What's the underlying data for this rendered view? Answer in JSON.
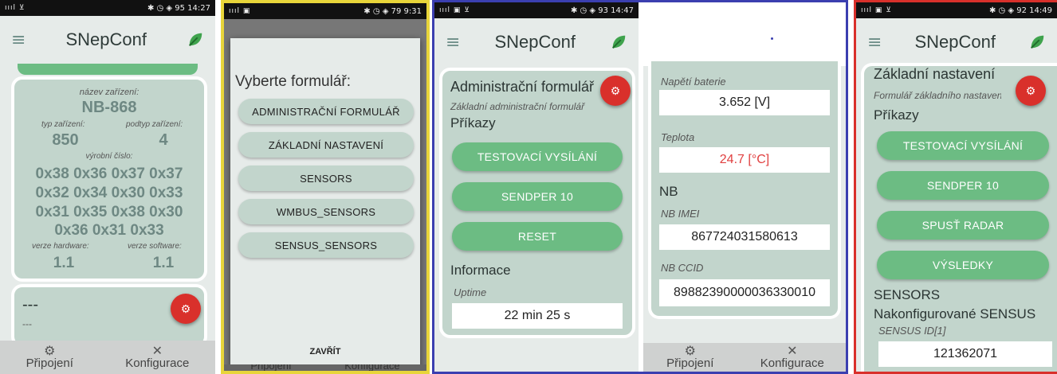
{
  "app_title": "SNepConf",
  "p1": {
    "status_left": "ıııl ⊻",
    "status_right": "✱ ◷ ◈ 95 14:27",
    "device_name_label": "název zařízení:",
    "device_name": "NB-868",
    "type_label": "typ zařízení:",
    "type": "850",
    "subtype_label": "podtyp zařízení:",
    "subtype": "4",
    "serial_label": "výrobní číslo:",
    "serial_lines": [
      "0x38 0x36 0x37 0x37",
      "0x32 0x34 0x30 0x33",
      "0x31 0x35 0x38 0x30",
      "0x36 0x31 0x33"
    ],
    "hw_label": "verze hardware:",
    "hw": "1.1",
    "sw_label": "verze software:",
    "sw": "1.1",
    "card2_title": "---",
    "card2_sub": "---",
    "nav_left": "Připojení",
    "nav_right": "Konfigurace"
  },
  "p2": {
    "status_left": "ıııl ▣",
    "status_right": "✱ ◷ ◈ 79 9:31",
    "dialog_title": "Vyberte formulář:",
    "items": [
      "ADMINISTRAČNÍ FORMULÁŘ",
      "ZÁKLADNÍ NASTAVENÍ",
      "SENSORS",
      "WMBUS_SENSORS",
      "SENSUS_SENSORS"
    ],
    "close": "ZAVŘÍT",
    "nav_left": "Připojení",
    "nav_right": "Konfigurace"
  },
  "p3": {
    "status_left": "ıııl ▣ ⊻",
    "status_right": "✱ ◷ ◈ 93 14:47",
    "form_title": "Administrační formulář",
    "form_sub": "Základní administrační formulář",
    "commands": "Příkazy",
    "btn1": "TESTOVACÍ VYSÍLÁNÍ",
    "btn2": "SENDPER 10",
    "btn3": "RESET",
    "info": "Informace",
    "uptime_label": "Uptime",
    "uptime": "22 min 25 s"
  },
  "p4": {
    "battery_label": "Napětí baterie",
    "battery": "3.652 [V]",
    "temp_label": "Teplota",
    "temp": "24.7 [°C]",
    "nb": "NB",
    "imei_label": "NB IMEI",
    "imei": "867724031580613",
    "ccid_label": "NB CCID",
    "ccid": "89882390000036330010",
    "nav_left": "Připojení",
    "nav_right": "Konfigurace"
  },
  "p5": {
    "status_left": "ıııl ▣ ⊻",
    "status_right": "✱ ◷ ◈ 92 14:49",
    "form_title": "Základní nastavení",
    "form_sub": "Formulář základního nastavení",
    "commands": "Příkazy",
    "btn1": "TESTOVACÍ VYSÍLÁNÍ",
    "btn2": "SENDPER 10",
    "btn3": "SPUSŤ RADAR",
    "btn4": "VÝSLEDKY",
    "sensors": "SENSORS",
    "configured": "Nakonfigurované SENSUS",
    "sensus_label": "SENSUS ID[1]",
    "sensus": "121362071"
  },
  "colors": {
    "accent_green": "#6cbc83",
    "card": "#c2d5cc",
    "fab_red": "#d9302b",
    "temp_red": "#e04040"
  }
}
